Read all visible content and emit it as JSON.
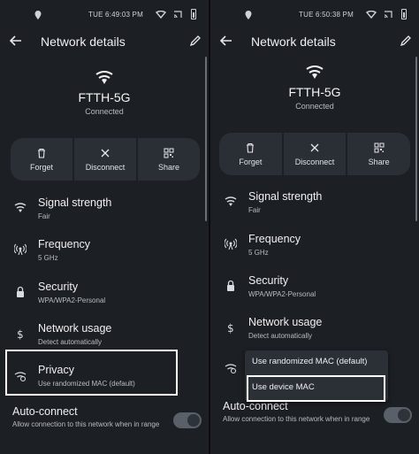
{
  "left": {
    "status": {
      "time": "TUE 6:49:03 PM"
    },
    "appbar": {
      "title": "Network details"
    },
    "network": {
      "ssid": "FTTH-5G",
      "state": "Connected"
    },
    "actions": [
      {
        "label": "Forget",
        "icon": "trash-icon"
      },
      {
        "label": "Disconnect",
        "icon": "close-icon"
      },
      {
        "label": "Share",
        "icon": "qr-code-icon"
      }
    ],
    "rows": [
      {
        "title": "Signal strength",
        "subtitle": "Fair",
        "icon": "wifi-signal-icon"
      },
      {
        "title": "Frequency",
        "subtitle": "5 GHz",
        "icon": "broadcast-icon"
      },
      {
        "title": "Security",
        "subtitle": "WPA/WPA2-Personal",
        "icon": "lock-icon"
      },
      {
        "title": "Network usage",
        "subtitle": "Detect automatically",
        "icon": "dollar-icon"
      },
      {
        "title": "Privacy",
        "subtitle": "Use randomized MAC (default)",
        "icon": "privacy-wifi-icon"
      }
    ],
    "auto_connect": {
      "title": "Auto-connect",
      "subtitle": "Allow connection to this network when in range",
      "enabled": true
    }
  },
  "right": {
    "status": {
      "time": "TUE 6:50:38 PM"
    },
    "appbar": {
      "title": "Network details"
    },
    "network": {
      "ssid": "FTTH-5G",
      "state": "Connected"
    },
    "actions": [
      {
        "label": "Forget",
        "icon": "trash-icon"
      },
      {
        "label": "Disconnect",
        "icon": "close-icon"
      },
      {
        "label": "Share",
        "icon": "qr-code-icon"
      }
    ],
    "rows": [
      {
        "title": "Signal strength",
        "subtitle": "Fair",
        "icon": "wifi-signal-icon"
      },
      {
        "title": "Frequency",
        "subtitle": "5 GHz",
        "icon": "broadcast-icon"
      },
      {
        "title": "Security",
        "subtitle": "WPA/WPA2-Personal",
        "icon": "lock-icon"
      },
      {
        "title": "Network usage",
        "subtitle": "Detect automatically",
        "icon": "dollar-icon"
      }
    ],
    "privacy_menu": {
      "options": [
        "Use randomized MAC (default)",
        "Use device MAC"
      ],
      "highlighted": "Use device MAC"
    },
    "auto_connect": {
      "title": "Auto-connect",
      "subtitle": "Allow connection to this network when in range",
      "enabled": true
    }
  },
  "colors": {
    "background": "#1c2024",
    "card": "#2a2f35",
    "highlight_border": "#ffffff"
  }
}
